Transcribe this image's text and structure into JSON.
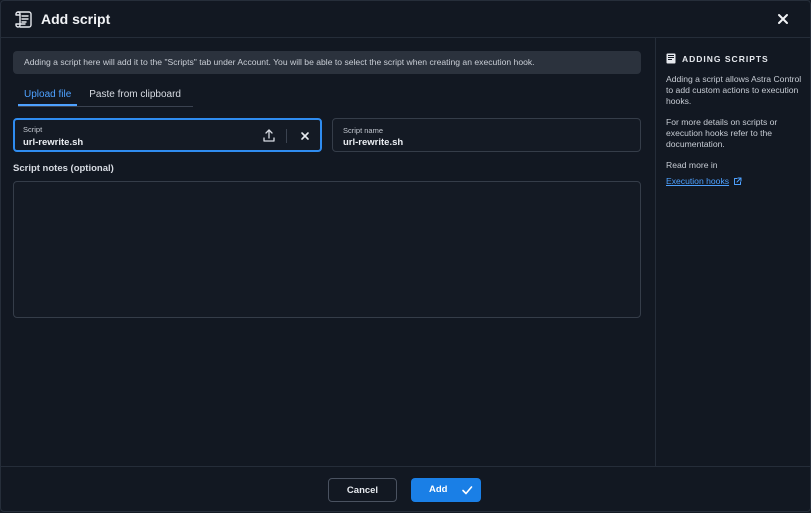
{
  "dialog": {
    "title": "Add script",
    "title_icon": "scroll-icon",
    "close_icon": "close-icon"
  },
  "banner": {
    "text": "Adding a script here will add it to the \"Scripts\" tab under Account. You will be able to select the script when creating an execution hook."
  },
  "tabs": [
    {
      "label": "Upload file",
      "active": true
    },
    {
      "label": "Paste from clipboard",
      "active": false
    }
  ],
  "script_field": {
    "label": "Script",
    "value": "url-rewrite.sh",
    "upload_icon": "upload-icon",
    "clear_icon": "close-icon"
  },
  "name_field": {
    "label": "Script name",
    "value": "url-rewrite.sh"
  },
  "notes": {
    "label": "Script notes (optional)",
    "value": ""
  },
  "sidebar": {
    "icon": "book-icon",
    "title": "ADDING SCRIPTS",
    "paragraph1": "Adding a script allows Astra Control to add custom actions to execution hooks.",
    "paragraph2": "For more details on scripts or execution hooks refer to the documentation.",
    "read_more": "Read more in",
    "link_label": "Execution hooks",
    "link_icon": "external-link-icon"
  },
  "footer": {
    "cancel_label": "Cancel",
    "add_label": "Add",
    "add_icon": "check-icon"
  },
  "colors": {
    "accent": "#1a7fe6",
    "link": "#4ea1ff",
    "background": "#121822"
  }
}
